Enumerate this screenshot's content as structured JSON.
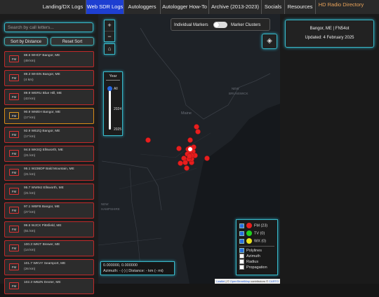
{
  "nav": {
    "items": [
      {
        "label": "Landing/DX Logs"
      },
      {
        "label": "Web SDR Logs"
      },
      {
        "label": "Autologgers"
      },
      {
        "label": "Autologger How-To"
      },
      {
        "label": "Archive (2013-2023)"
      },
      {
        "label": "Socials"
      },
      {
        "label": "Resources"
      },
      {
        "label": "HD Radio Directory"
      }
    ]
  },
  "sidebar": {
    "search_placeholder": "Search by call letters...",
    "sort_distance": "Sort by Distance",
    "reset_sort": "Reset Sort",
    "stations": [
      {
        "badge": "FM",
        "name": "88.5 WHCF Bangor, ME",
        "dist": "(49 km)"
      },
      {
        "badge": "FM",
        "name": "89.3 WHSN Bangor, ME",
        "dist": "(4 km)"
      },
      {
        "badge": "FM",
        "name": "89.9 WERU Blue Hill, ME",
        "dist": "(43 km)"
      },
      {
        "badge": "FM",
        "name": "90.9 WMEH Bangor, ME",
        "dist": "(17 km)"
      },
      {
        "badge": "FM",
        "name": "92.9 WEZQ Bangor, ME",
        "dist": "(17 km)"
      },
      {
        "badge": "FM",
        "name": "94.5 WKSQ Ellsworth, ME",
        "dist": "(21 km)"
      },
      {
        "badge": "FM",
        "name": "95.1 W236DP Bald Mountain, ME",
        "dist": "(21 km)"
      },
      {
        "badge": "FM",
        "name": "95.7 WWMJ Ellsworth, ME",
        "dist": "(21 km)"
      },
      {
        "badge": "FM",
        "name": "97.1 WBFB Bangor, ME",
        "dist": "(27 km)"
      },
      {
        "badge": "FM",
        "name": "99.5 WJCX Pittsfield, ME",
        "dist": "(51 km)"
      },
      {
        "badge": "FM",
        "name": "100.3 WKIT Brewer, ME",
        "dist": "(14 km)"
      },
      {
        "badge": "FM",
        "name": "101.7 WKVY Searsport, ME",
        "dist": "(26 km)"
      },
      {
        "badge": "FM",
        "name": "102.3 WBZN Dexter, ME",
        "dist": ""
      }
    ]
  },
  "map": {
    "zoom_in": "+",
    "zoom_out": "−",
    "toggle_left": "Individual Markers",
    "toggle_right": "Marker Clusters",
    "year_label": "Year",
    "year_all": "All",
    "year_2024": "2024",
    "year_2025": "2025",
    "coords_line1": "0.000000, 0.000000",
    "coords_line2": "Azimuth: - (-) | Distance: - km (- mi)",
    "legend": {
      "fm": "FM (23)",
      "tv": "TV (0)",
      "wx": "WX (0)",
      "polylines": "Polylines",
      "azimuth": "Azimuth",
      "radius": "Radius",
      "propagation": "Propagation"
    },
    "labels": {
      "maine": "Maine",
      "new_brunswick": "NEW\nBRUNSWICK",
      "new_hampshire": "NEW\nHAMPSHIRE",
      "quebec": "QUÉBEC"
    },
    "attribution": {
      "leaflet": "Leaflet",
      "sep": " | © ",
      "osm": "OpenStreetMap",
      "mid": " contributors © ",
      "carto": "CARTO"
    }
  },
  "info": {
    "line1": "Bangor, ME | FN54ot",
    "line2": "Updated: 4 February 2025"
  },
  "colors": {
    "fm": "#e81e1e",
    "tv": "#1fd21f",
    "wx": "#e9e21d",
    "accent": "#39b7c6",
    "active_nav": "#1e3fd1"
  }
}
